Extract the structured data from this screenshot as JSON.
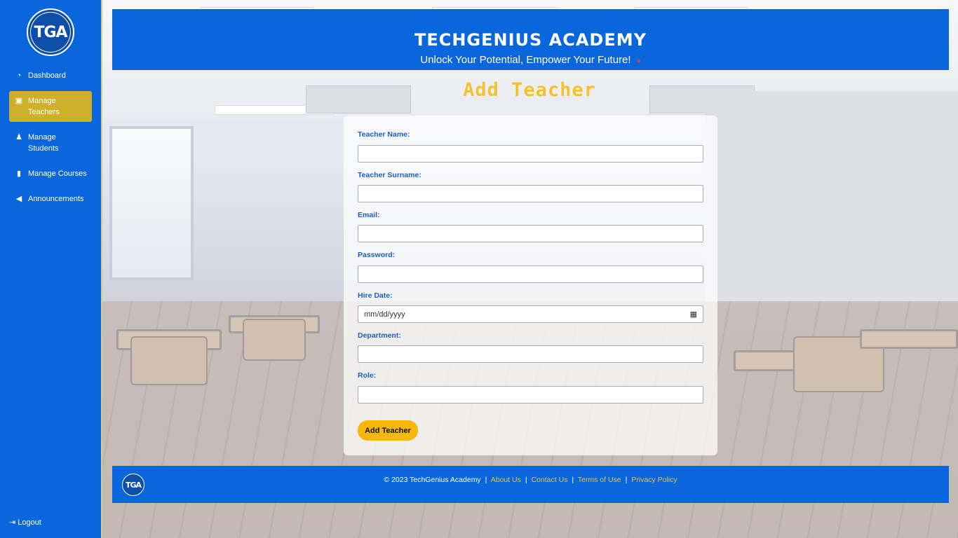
{
  "sidebar": {
    "logo_text": "TGA",
    "items": [
      {
        "label": "Dashboard",
        "icon": "gauge-icon"
      },
      {
        "label": "Manage Teachers",
        "icon": "teacher-icon"
      },
      {
        "label": "Manage Students",
        "icon": "student-icon"
      },
      {
        "label": "Manage Courses",
        "icon": "book-icon"
      },
      {
        "label": "Announcements",
        "icon": "megaphone-icon"
      }
    ],
    "active_item": "Manage Teachers",
    "logout_label": "Logout"
  },
  "header": {
    "title": "TECHGENIUS ACADEMY",
    "subtitle": "Unlock Your Potential, Empower Your Future!"
  },
  "page": {
    "title": "Add Teacher"
  },
  "form": {
    "fields": [
      {
        "label": "Teacher Name:",
        "value": ""
      },
      {
        "label": "Teacher Surname:",
        "value": ""
      },
      {
        "label": "Email:",
        "value": ""
      },
      {
        "label": "Password:",
        "value": ""
      },
      {
        "label": "Hire Date:",
        "value": "",
        "placeholder": "mm/dd/yyyy"
      },
      {
        "label": "Department:",
        "value": ""
      },
      {
        "label": "Role:",
        "value": ""
      }
    ],
    "submit_label": "Add Teacher"
  },
  "footer": {
    "logo_text": "TGA",
    "copyright": "© 2023 TechGenius Academy",
    "links": [
      "About Us",
      "Contact Us",
      "Terms of Use",
      "Privacy Policy"
    ]
  },
  "colors": {
    "primary": "#0a66dc",
    "accent": "#cfb02a",
    "button": "#f6b80c",
    "title": "#f2c230",
    "link": "#f0c23a"
  }
}
